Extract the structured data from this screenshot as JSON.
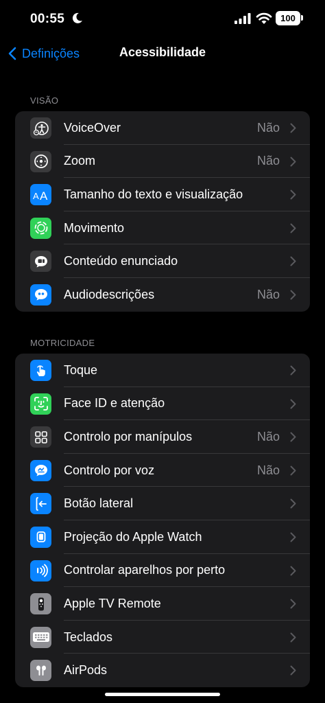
{
  "status_bar": {
    "time": "00:55",
    "battery": "100"
  },
  "nav": {
    "back_label": "Definições",
    "title": "Acessibilidade"
  },
  "sections": {
    "vision": {
      "header": "VISÃO",
      "items": [
        {
          "label": "VoiceOver",
          "value": "Não",
          "icon": "voiceover-icon",
          "color": "#3a3a3c"
        },
        {
          "label": "Zoom",
          "value": "Não",
          "icon": "zoom-icon",
          "color": "#3a3a3c"
        },
        {
          "label": "Tamanho do texto e visualização",
          "value": "",
          "icon": "text-size-icon",
          "color": "#0a84ff"
        },
        {
          "label": "Movimento",
          "value": "",
          "icon": "motion-icon",
          "color": "#30d158"
        },
        {
          "label": "Conteúdo enunciado",
          "value": "",
          "icon": "spoken-content-icon",
          "color": "#3a3a3c"
        },
        {
          "label": "Audiodescrições",
          "value": "Não",
          "icon": "audio-descriptions-icon",
          "color": "#0a84ff"
        }
      ]
    },
    "motor": {
      "header": "MOTRICIDADE",
      "items": [
        {
          "label": "Toque",
          "value": "",
          "icon": "touch-icon",
          "color": "#0a84ff"
        },
        {
          "label": "Face ID e atenção",
          "value": "",
          "icon": "face-id-icon",
          "color": "#30d158"
        },
        {
          "label": "Controlo por manípulos",
          "value": "Não",
          "icon": "switch-control-icon",
          "color": "#3a3a3c"
        },
        {
          "label": "Controlo por voz",
          "value": "Não",
          "icon": "voice-control-icon",
          "color": "#0a84ff"
        },
        {
          "label": "Botão lateral",
          "value": "",
          "icon": "side-button-icon",
          "color": "#0a84ff"
        },
        {
          "label": "Projeção do Apple Watch",
          "value": "",
          "icon": "apple-watch-mirroring-icon",
          "color": "#0a84ff"
        },
        {
          "label": "Controlar aparelhos por perto",
          "value": "",
          "icon": "nearby-devices-icon",
          "color": "#0a84ff"
        },
        {
          "label": "Apple TV Remote",
          "value": "",
          "icon": "apple-tv-remote-icon",
          "color": "#8e8e93"
        },
        {
          "label": "Teclados",
          "value": "",
          "icon": "keyboard-icon",
          "color": "#8e8e93"
        },
        {
          "label": "AirPods",
          "value": "",
          "icon": "airpods-icon",
          "color": "#8e8e93"
        }
      ]
    }
  }
}
